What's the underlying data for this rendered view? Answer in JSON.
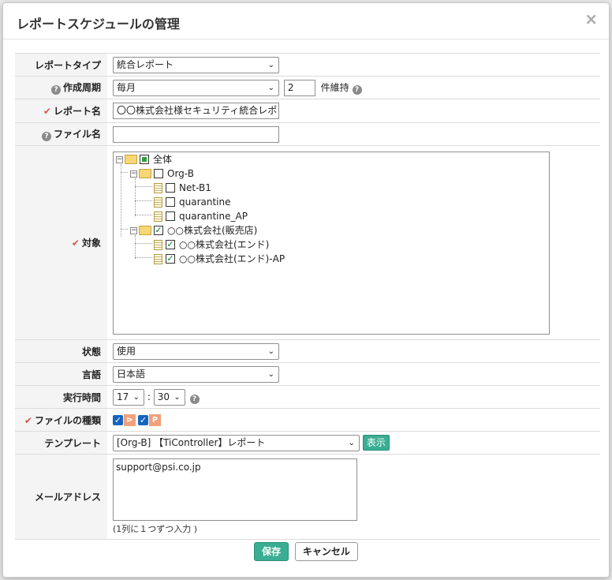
{
  "dialog": {
    "title": "レポートスケジュールの管理",
    "close_symbol": "×"
  },
  "form": {
    "report_type": {
      "label": "レポートタイプ",
      "value": "統合レポート"
    },
    "cycle": {
      "label": "作成周期",
      "value": "毎月",
      "keep_count": "2",
      "keep_label": "件維持"
    },
    "report_name": {
      "label": "レポート名",
      "value": "〇〇株式会社様セキュリティ統合レポ"
    },
    "file_name": {
      "label": "ファイル名",
      "value": ""
    },
    "target": {
      "label": "対象",
      "tree": [
        {
          "label": "全体",
          "state": "partial",
          "kind": "folder",
          "expanded": true
        },
        {
          "label": "Org-B",
          "state": "unchecked",
          "kind": "folder",
          "expanded": true
        },
        {
          "label": "Net-B1",
          "state": "unchecked",
          "kind": "leaf"
        },
        {
          "label": "quarantine",
          "state": "unchecked",
          "kind": "leaf"
        },
        {
          "label": "quarantine_AP",
          "state": "unchecked",
          "kind": "leaf"
        },
        {
          "label": "○○株式会社(販売店)",
          "state": "checked",
          "kind": "folder",
          "expanded": true
        },
        {
          "label": "○○株式会社(エンド)",
          "state": "checked",
          "kind": "leaf"
        },
        {
          "label": "○○株式会社(エンド)-AP",
          "state": "checked",
          "kind": "leaf"
        }
      ]
    },
    "status": {
      "label": "状態",
      "value": "使用"
    },
    "language": {
      "label": "言語",
      "value": "日本語"
    },
    "exec_time": {
      "label": "実行時間",
      "hour": "17",
      "minute": "30",
      "separator": ":"
    },
    "file_types": {
      "label": "ファイルの種類",
      "icon1": "⊳",
      "icon2": "P"
    },
    "template": {
      "label": "テンプレート",
      "value": "[Org-B] 【TiController】レポート",
      "show_button": "表示"
    },
    "email": {
      "label": "メールアドレス",
      "value": "support@psi.co.jp",
      "hint": "(1列に１つずつ入力 )"
    }
  },
  "footer": {
    "save": "保存",
    "cancel": "キャンセル"
  },
  "colors": {
    "accent": "#3aae92",
    "required": "#d9534f",
    "checkbox": "#1565c0"
  }
}
